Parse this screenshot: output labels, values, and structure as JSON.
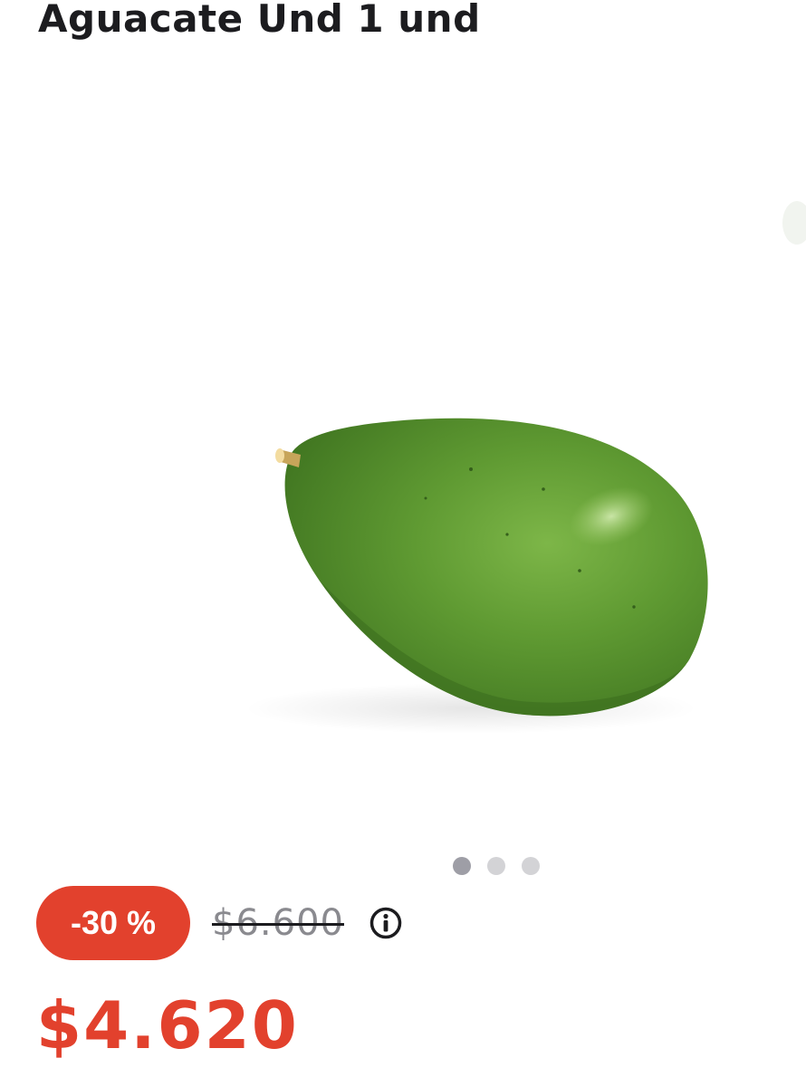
{
  "product": {
    "title": "Aguacate Und 1 und"
  },
  "gallery": {
    "image_subject": "avocado",
    "slide_count": 3,
    "active_slide": 1
  },
  "pricing": {
    "discount_label": "-30 %",
    "original_price": "$6.600",
    "current_price": "$4.620",
    "info_icon": "info-circle-icon"
  },
  "colors": {
    "accent": "#e2412d",
    "badge_text": "#ffffff",
    "title_text": "#1c1c1f",
    "old_price_text": "#8a8a8f",
    "dot_active": "#9e9ea6",
    "dot_inactive": "#d3d3d6",
    "avocado_green": "#5f9a32"
  }
}
